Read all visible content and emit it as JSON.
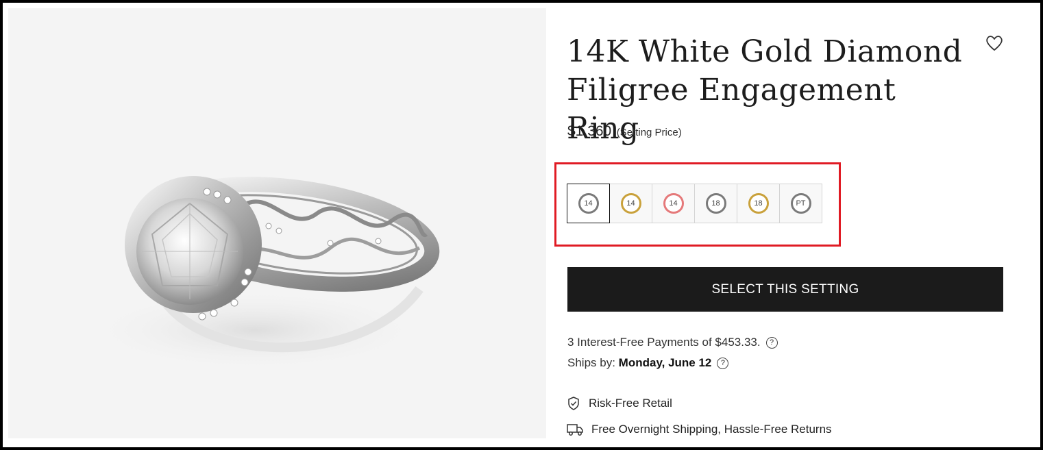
{
  "product": {
    "title_line1": "14K White Gold Diamond",
    "title_line2": "Filigree Engagement Ring",
    "price": "$1,360",
    "price_note": "(Setting Price)",
    "wishlist_icon": "heart-outline-icon"
  },
  "metals": [
    {
      "label": "14",
      "color": "#7a7a7a",
      "name": "14k-white-gold",
      "selected": true
    },
    {
      "label": "14",
      "color": "#c9a13b",
      "name": "14k-yellow-gold",
      "selected": false
    },
    {
      "label": "14",
      "color": "#e5797a",
      "name": "14k-rose-gold",
      "selected": false
    },
    {
      "label": "18",
      "color": "#7a7a7a",
      "name": "18k-white-gold",
      "selected": false
    },
    {
      "label": "18",
      "color": "#c9a13b",
      "name": "18k-yellow-gold",
      "selected": false
    },
    {
      "label": "PT",
      "color": "#7a7a7a",
      "name": "platinum",
      "selected": false
    }
  ],
  "highlight_color": "#e01b24",
  "cta": {
    "label": "SELECT THIS SETTING",
    "color": "#1b1b1b"
  },
  "payments": {
    "text": "3 Interest-Free Payments of $453.33."
  },
  "shipping": {
    "label": "Ships by:",
    "date": "Monday, June 12"
  },
  "features": [
    {
      "icon": "shield-check-icon",
      "text": "Risk-Free Retail"
    },
    {
      "icon": "truck-icon",
      "text": "Free Overnight Shipping, Hassle-Free Returns"
    }
  ]
}
